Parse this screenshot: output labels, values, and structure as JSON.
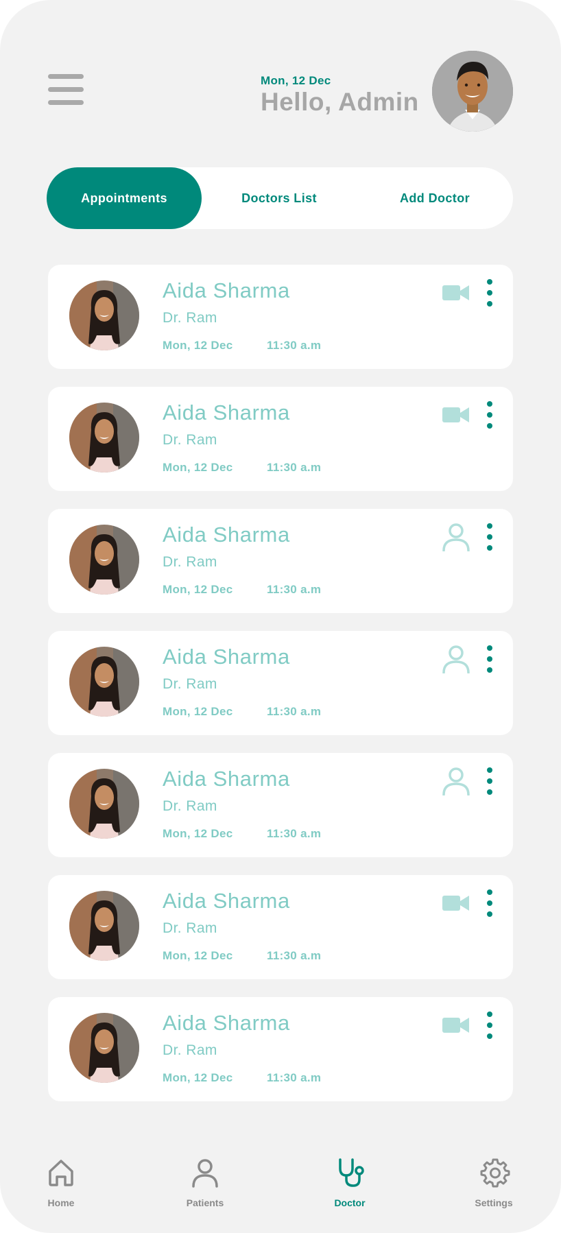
{
  "header": {
    "date": "Mon, 12 Dec",
    "greeting": "Hello, Admin",
    "menu_icon": "hamburger-menu-icon"
  },
  "tabs": [
    {
      "label": "Appointments",
      "active": true
    },
    {
      "label": "Doctors List",
      "active": false
    },
    {
      "label": "Add Doctor",
      "active": false
    }
  ],
  "appointments": [
    {
      "patient": "Aida Sharma",
      "doctor": "Dr. Ram",
      "date": "Mon, 12 Dec",
      "time": "11:30 a.m",
      "type_icon": "video-camera-icon"
    },
    {
      "patient": "Aida Sharma",
      "doctor": "Dr. Ram",
      "date": "Mon, 12 Dec",
      "time": "11:30 a.m",
      "type_icon": "video-camera-icon"
    },
    {
      "patient": "Aida Sharma",
      "doctor": "Dr. Ram",
      "date": "Mon, 12 Dec",
      "time": "11:30 a.m",
      "type_icon": "person-icon"
    },
    {
      "patient": "Aida Sharma",
      "doctor": "Dr. Ram",
      "date": "Mon, 12 Dec",
      "time": "11:30 a.m",
      "type_icon": "person-icon"
    },
    {
      "patient": "Aida Sharma",
      "doctor": "Dr. Ram",
      "date": "Mon, 12 Dec",
      "time": "11:30 a.m",
      "type_icon": "person-icon"
    },
    {
      "patient": "Aida Sharma",
      "doctor": "Dr. Ram",
      "date": "Mon, 12 Dec",
      "time": "11:30 a.m",
      "type_icon": "video-camera-icon"
    },
    {
      "patient": "Aida Sharma",
      "doctor": "Dr. Ram",
      "date": "Mon, 12 Dec",
      "time": "11:30 a.m",
      "type_icon": "video-camera-icon"
    }
  ],
  "bottom_nav": [
    {
      "label": "Home",
      "icon": "home-icon",
      "active": false
    },
    {
      "label": "Patients",
      "icon": "person-icon",
      "active": false
    },
    {
      "label": "Doctor",
      "icon": "stethoscope-icon",
      "active": true
    },
    {
      "label": "Settings",
      "icon": "gear-icon",
      "active": false
    }
  ],
  "colors": {
    "accent": "#00897b",
    "accent_light": "#80cbc4",
    "icon_light": "#b2dfdb",
    "background": "#f2f2f2",
    "muted_text": "#a6a6a6"
  }
}
